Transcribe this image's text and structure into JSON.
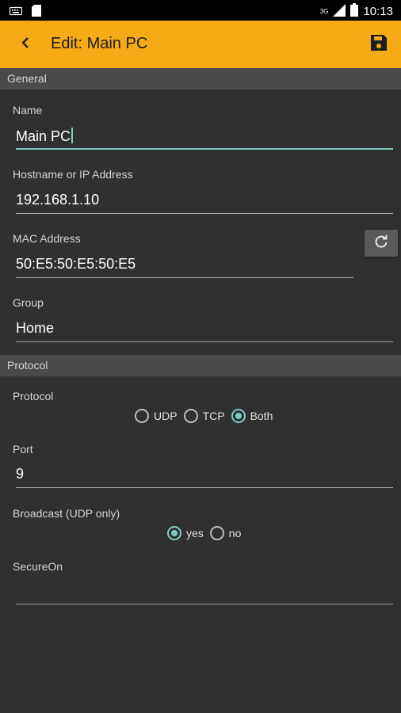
{
  "status_bar": {
    "time": "10:13",
    "network": "3G",
    "icons": [
      "keyboard-icon",
      "sd-card-icon",
      "signal-icon",
      "battery-icon"
    ]
  },
  "app_bar": {
    "title": "Edit: Main PC",
    "back_icon": "arrow-back-icon",
    "save_icon": "save-icon",
    "color": "#f6aa16"
  },
  "sections": {
    "general": "General",
    "protocol": "Protocol"
  },
  "fields": {
    "name": {
      "label": "Name",
      "value": "Main PC"
    },
    "host": {
      "label": "Hostname or IP Address",
      "value": "192.168.1.10"
    },
    "mac": {
      "label": "MAC Address",
      "value": "50:E5:50:E5:50:E5",
      "refresh_icon": "refresh-icon"
    },
    "group": {
      "label": "Group",
      "value": "Home"
    },
    "port": {
      "label": "Port",
      "value": "9"
    },
    "secureon": {
      "label": "SecureOn",
      "value": ""
    }
  },
  "protocol": {
    "label": "Protocol",
    "options": [
      "UDP",
      "TCP",
      "Both"
    ],
    "selected": "Both"
  },
  "broadcast": {
    "label": "Broadcast (UDP only)",
    "options": [
      "yes",
      "no"
    ],
    "selected": "yes"
  },
  "colors": {
    "accent": "#80cbc4",
    "background": "#303030",
    "section": "#4a4a4a"
  }
}
